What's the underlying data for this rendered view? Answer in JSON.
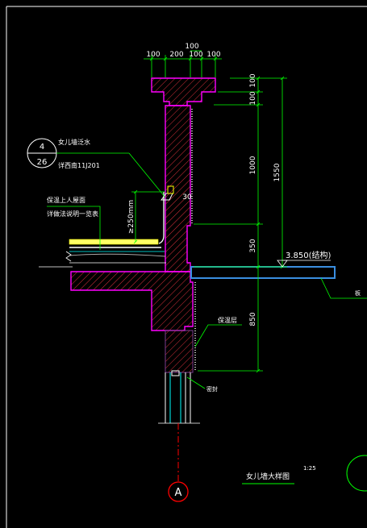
{
  "drawing": {
    "title": "女儿墙大样图",
    "scale": "1:25",
    "axis_label": "A",
    "detail_ref": {
      "number": "4",
      "sheet": "26"
    }
  },
  "dimensions": {
    "top": [
      "100",
      "200",
      "100",
      "100",
      "100"
    ],
    "right": [
      "100",
      "100",
      "1000",
      "1550",
      "350",
      "850",
      "30"
    ],
    "slope": "≥250mm",
    "elevation": "3.850(结构)"
  },
  "annotations": {
    "flashing": "女儿墙泛水",
    "flashing_ref": "详西南11J201",
    "roof": "保温上人屋面",
    "roof_ref": "详做法说明一览表",
    "insulation": "保温层",
    "sealant": "密封",
    "cut_label": "板"
  },
  "colors": {
    "background": "#000000",
    "dimension": "#00ff00",
    "concrete_outline": "#ff00ff",
    "hatch": "#ff3b3b",
    "slab": "#3a8ee0",
    "text": "#ffffff",
    "leader": "#00ff00",
    "mortar": "#ffff00"
  }
}
